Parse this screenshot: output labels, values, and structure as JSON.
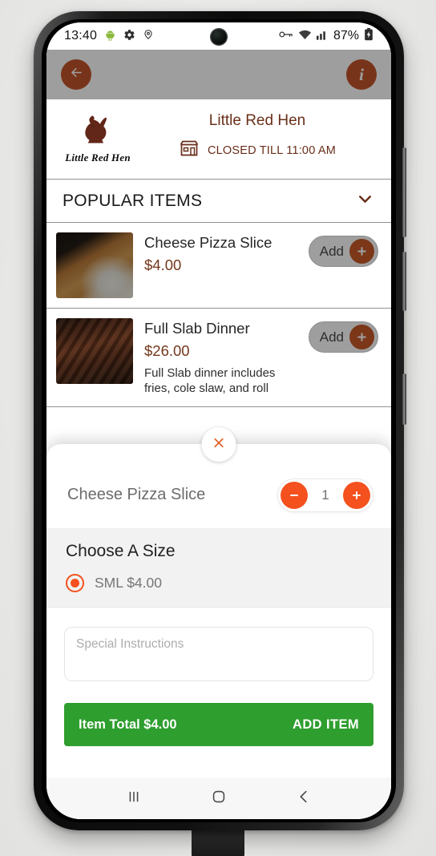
{
  "status_bar": {
    "time": "13:40",
    "battery_percent": "87%",
    "icons_left": [
      "android-robot-icon",
      "gear-icon",
      "location-pin-icon"
    ],
    "icons_right": [
      "vpn-key-icon",
      "wifi-icon",
      "signal-bars-icon",
      "battery-charging-icon"
    ]
  },
  "app_bar": {
    "back_icon": "arrow-left-icon",
    "info_icon": "info-icon",
    "info_label": "i"
  },
  "restaurant": {
    "name": "Little Red Hen",
    "logo_text": "Little Red Hen",
    "logo_icon": "hen-logo-icon",
    "status_icon": "storefront-icon",
    "status_text": "CLOSED TILL 11:00 AM"
  },
  "section": {
    "title": "POPULAR ITEMS",
    "collapse_icon": "chevron-down-icon"
  },
  "menu_items": [
    {
      "name": "Cheese Pizza Slice",
      "price": "$4.00",
      "description": "",
      "add_label": "Add",
      "add_icon": "plus-icon",
      "thumb": "pizza"
    },
    {
      "name": "Full Slab Dinner",
      "price": "$26.00",
      "description": "Full Slab dinner includes fries, cole slaw, and roll",
      "add_label": "Add",
      "add_icon": "plus-icon",
      "thumb": "ribs"
    }
  ],
  "sheet": {
    "close_icon": "close-icon",
    "item_name": "Cheese Pizza Slice",
    "decrement_icon": "minus-icon",
    "increment_icon": "plus-icon",
    "quantity": "1",
    "choose_title": "Choose A Size",
    "options": [
      {
        "label": "SML $4.00",
        "selected": true
      }
    ],
    "instructions_placeholder": "Special Instructions",
    "instructions_value": "",
    "total_label": "Item Total $4.00",
    "add_item_label": "ADD ITEM"
  },
  "nav_bar": {
    "recents_icon": "recents-icon",
    "home_icon": "home-icon",
    "back_icon": "back-chevron-icon"
  },
  "colors": {
    "accent_orange": "#F4511E",
    "accent_orange_dark": "#DF4E14",
    "price_orange": "#D4561B",
    "green": "#2E9E2E"
  }
}
